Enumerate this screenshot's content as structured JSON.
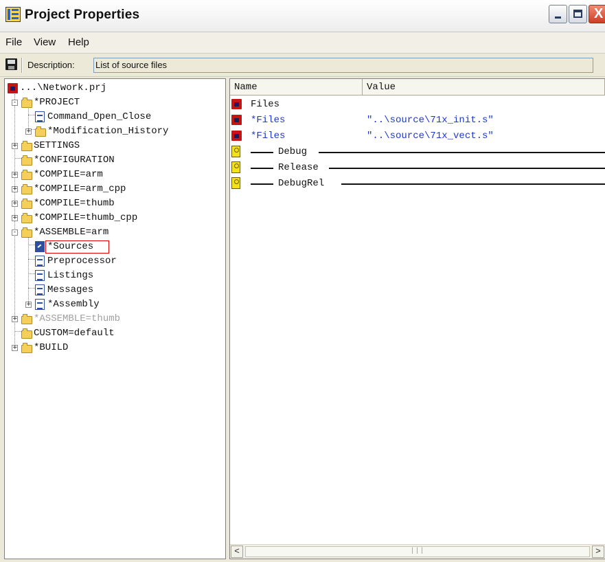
{
  "window": {
    "title": "Project Properties",
    "close_glyph": "X"
  },
  "menu": {
    "items": [
      "File",
      "View",
      "Help"
    ]
  },
  "toolbar": {
    "description_label": "Description:",
    "description_value": "List of source files"
  },
  "tree": {
    "items": [
      {
        "label": "...\\Network.prj",
        "icon": "disk-icon"
      },
      {
        "label": "*PROJECT",
        "icon": "folder-icon",
        "expander": "-"
      },
      {
        "label": "Command_Open_Close",
        "icon": "document-icon"
      },
      {
        "label": "*Modification_History",
        "icon": "folder-icon",
        "expander": "+"
      },
      {
        "label": "SETTINGS",
        "icon": "folder-icon",
        "expander": "+"
      },
      {
        "label": "*CONFIGURATION",
        "icon": "folder-icon"
      },
      {
        "label": "*COMPILE=arm",
        "icon": "folder-icon",
        "expander": "+"
      },
      {
        "label": "*COMPILE=arm_cpp",
        "icon": "folder-icon",
        "expander": "+"
      },
      {
        "label": "*COMPILE=thumb",
        "icon": "folder-icon",
        "expander": "+"
      },
      {
        "label": "*COMPILE=thumb_cpp",
        "icon": "folder-icon",
        "expander": "+"
      },
      {
        "label": "*ASSEMBLE=arm",
        "icon": "folder-icon",
        "expander": "-"
      },
      {
        "label": "*Sources",
        "icon": "edit-document-icon",
        "selected": true
      },
      {
        "label": "Preprocessor",
        "icon": "document-icon"
      },
      {
        "label": "Listings",
        "icon": "document-icon"
      },
      {
        "label": "Messages",
        "icon": "document-icon"
      },
      {
        "label": "*Assembly",
        "icon": "document-icon",
        "expander": "+"
      },
      {
        "label": "*ASSEMBLE=thumb",
        "icon": "folder-icon",
        "expander": "+",
        "disabled": true
      },
      {
        "label": "CUSTOM=default",
        "icon": "folder-icon"
      },
      {
        "label": "*BUILD",
        "icon": "folder-icon",
        "expander": "+"
      }
    ]
  },
  "list": {
    "columns": {
      "name": "Name",
      "value": "Value"
    },
    "rows": [
      {
        "name": "Files",
        "value": "",
        "icon": "disk-icon",
        "color": "#111111"
      },
      {
        "name": "*Files",
        "value": "\"..\\source\\71x_init.s\"",
        "icon": "disk-icon",
        "color": "#1f37c8"
      },
      {
        "name": "*Files",
        "value": "\"..\\source\\71x_vect.s\"",
        "icon": "disk-icon",
        "color": "#1f37c8"
      },
      {
        "name": "Debug",
        "icon": "key-icon",
        "type": "group"
      },
      {
        "name": "Release",
        "icon": "key-icon",
        "type": "group"
      },
      {
        "name": "DebugRel",
        "icon": "key-icon",
        "type": "group"
      }
    ]
  },
  "scrollbar": {
    "left_arrow": "<",
    "right_arrow": ">",
    "thumb_grip": "|||"
  },
  "colors": {
    "selection_border": "#e00000",
    "link_blue": "#1f37c8",
    "disabled_text": "#a0a0a0"
  }
}
